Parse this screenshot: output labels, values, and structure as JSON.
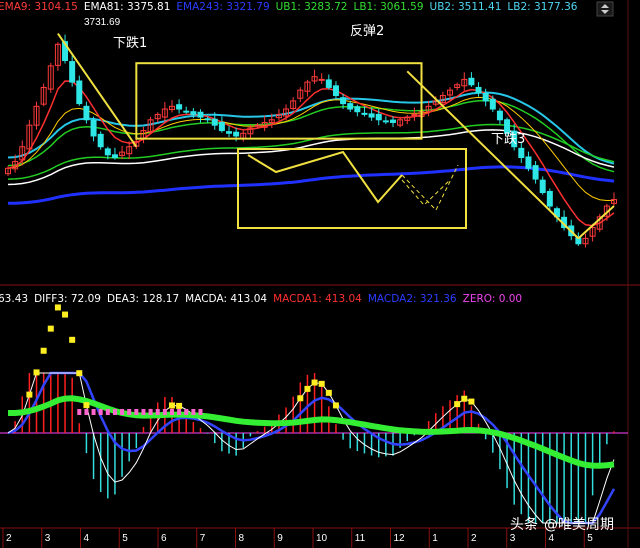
{
  "colors": {
    "background": "#000000",
    "candle_up": "#ff3b3b",
    "candle_down": "#2ee6e6",
    "ema9": "#ff3030",
    "ema81": "#ffffff",
    "ema_blue": "#2030ff",
    "ub1": "#22cc22",
    "lb1": "#22cc22",
    "ub2": "#27c7e8",
    "lb2": "#27c7e8",
    "annotation": "#f0e040",
    "diff_bar": "#ff66cc",
    "dea_green": "#33ee33",
    "macd_pos": "#ff2020",
    "macd_neg": "#33dddd",
    "zero": "#ff44ff",
    "yellow_dots": "#ffee22",
    "blue_line": "#3344ff"
  },
  "top_legend": {
    "items": [
      {
        "text": "EMA9: 3104.15",
        "color": "#ff3b3b"
      },
      {
        "text": "EMA81: 3375.81",
        "color": "#ffffff"
      },
      {
        "text": "EMA243: 3321.79",
        "color": "#2a3cff"
      },
      {
        "text": "UB1: 3283.72",
        "color": "#33dd33"
      },
      {
        "text": "LB1: 3061.59",
        "color": "#33dd33"
      },
      {
        "text": "UB2: 3511.41",
        "color": "#4fd7f2"
      },
      {
        "text": "LB2: 3177.36",
        "color": "#4fd7f2"
      }
    ],
    "peak_label": "3731.69",
    "corner_icon": "up-down-arrow-icon"
  },
  "macd_legend": {
    "items": [
      {
        "text": "63.43",
        "color": "#ffffff"
      },
      {
        "text": "DIFF3: 72.09",
        "color": "#ffffff"
      },
      {
        "text": "DEA3: 128.17",
        "color": "#ffffff"
      },
      {
        "text": "MACDA: 413.04",
        "color": "#ffffff"
      },
      {
        "text": "MACDA1: 413.04",
        "color": "#ff3030"
      },
      {
        "text": "MACDA2: 321.36",
        "color": "#2a3cff"
      },
      {
        "text": "ZERO: 0.00",
        "color": "#ee44ee"
      }
    ]
  },
  "annotations": {
    "drop1": "下跌1",
    "rebound2": "反弹2",
    "drop3": "下跌3"
  },
  "x_ticks": [
    "2",
    "3",
    "4",
    "5",
    "6",
    "7",
    "8",
    "9",
    "10",
    "11",
    "12",
    "1",
    "2",
    "3",
    "4",
    "5"
  ],
  "watermark": {
    "brand": "头条",
    "handle": "@唯美周期"
  },
  "chart_data": {
    "type": "candlestick",
    "title": "",
    "price_series": [
      {
        "name": "EMA9",
        "value": 3104.15
      },
      {
        "name": "EMA81",
        "value": 3375.81
      },
      {
        "name": "EMA243",
        "value": 3321.79
      },
      {
        "name": "UB1",
        "value": 3283.72
      },
      {
        "name": "LB1",
        "value": 3061.59
      },
      {
        "name": "UB2",
        "value": 3511.41
      },
      {
        "name": "LB2",
        "value": 3177.36
      }
    ],
    "price_annotation": 3731.69,
    "macd_series": [
      {
        "name": "DIFF3",
        "value": 72.09
      },
      {
        "name": "DEA3",
        "value": 128.17
      },
      {
        "name": "MACDA",
        "value": 413.04
      },
      {
        "name": "MACDA1",
        "value": 413.04
      },
      {
        "name": "MACDA2",
        "value": 321.36
      },
      {
        "name": "ZERO",
        "value": 0.0
      }
    ],
    "ylim": [
      2850,
      3800
    ],
    "close": [
      3220,
      3245,
      3300,
      3380,
      3450,
      3520,
      3600,
      3680,
      3620,
      3540,
      3460,
      3400,
      3340,
      3300,
      3270,
      3260,
      3280,
      3300,
      3320,
      3360,
      3400,
      3420,
      3440,
      3450,
      3440,
      3430,
      3420,
      3410,
      3400,
      3380,
      3360,
      3350,
      3340,
      3350,
      3370,
      3380,
      3390,
      3400,
      3420,
      3440,
      3470,
      3510,
      3540,
      3560,
      3550,
      3520,
      3490,
      3460,
      3440,
      3430,
      3420,
      3410,
      3400,
      3395,
      3390,
      3400,
      3410,
      3420,
      3430,
      3450,
      3470,
      3490,
      3510,
      3530,
      3550,
      3530,
      3500,
      3470,
      3440,
      3400,
      3350,
      3300,
      3260,
      3220,
      3180,
      3130,
      3080,
      3040,
      3000,
      2970,
      2940,
      2960,
      3000,
      3040,
      3080,
      3104
    ]
  }
}
